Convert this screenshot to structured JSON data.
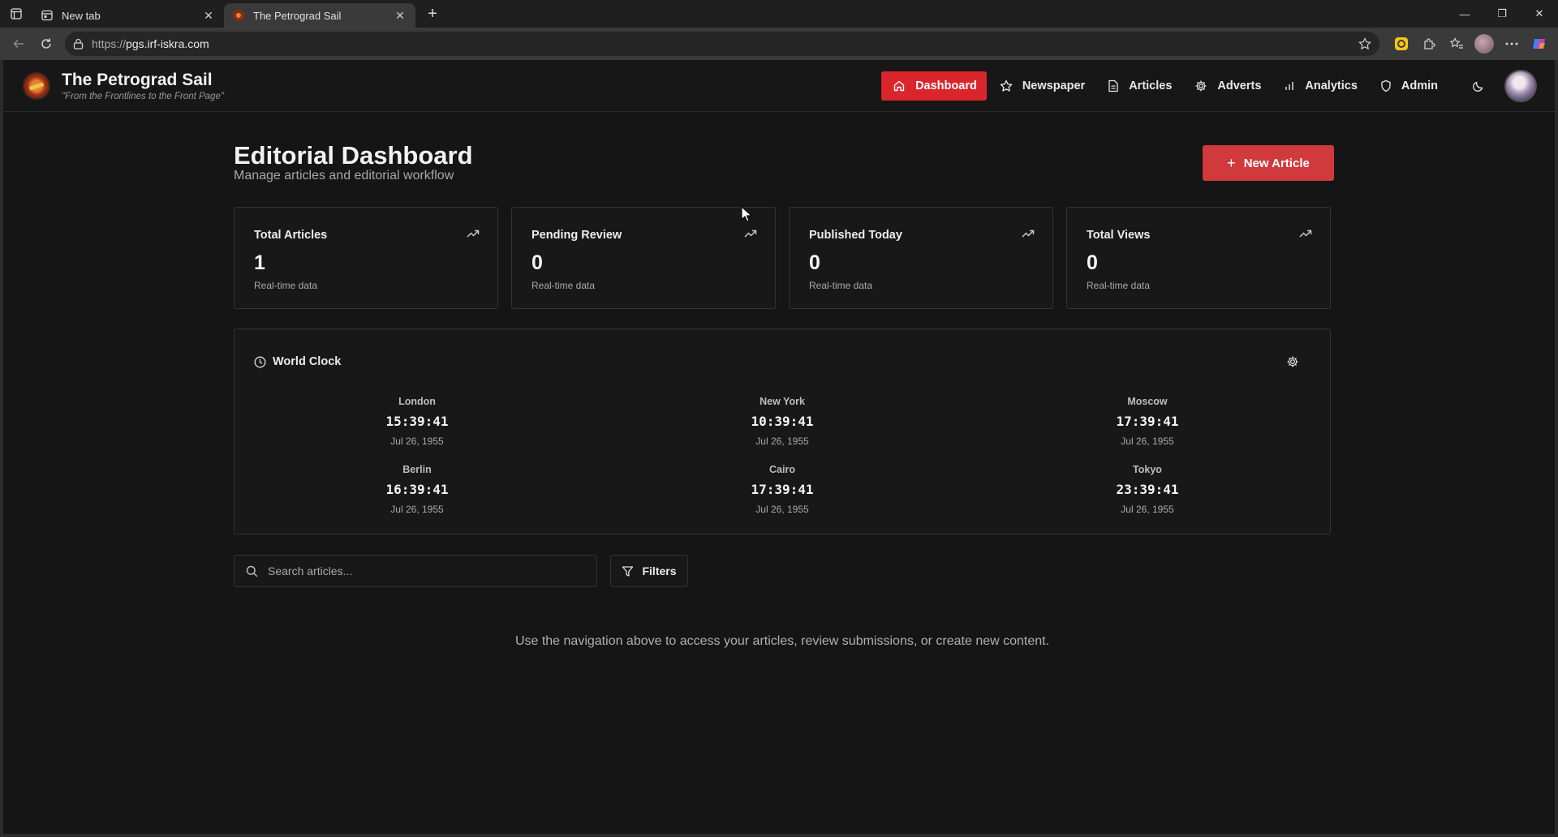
{
  "browser": {
    "tabs": [
      {
        "title": "New tab",
        "active": false
      },
      {
        "title": "The Petrograd Sail",
        "active": true
      }
    ],
    "address": {
      "protocol": "https://",
      "host": "pgs.irf-iskra.com"
    }
  },
  "site": {
    "title": "The Petrograd Sail",
    "tagline": "\"From the Frontlines to the Front Page\"",
    "nav": [
      {
        "label": "Dashboard",
        "icon": "home-icon",
        "active": true
      },
      {
        "label": "Newspaper",
        "icon": "star-icon",
        "active": false
      },
      {
        "label": "Articles",
        "icon": "document-icon",
        "active": false
      },
      {
        "label": "Adverts",
        "icon": "gear-icon",
        "active": false
      },
      {
        "label": "Analytics",
        "icon": "bar-chart-icon",
        "active": false
      },
      {
        "label": "Admin",
        "icon": "shield-icon",
        "active": false
      }
    ],
    "accent": "#d9252b"
  },
  "dashboard": {
    "title": "Editorial Dashboard",
    "subtitle": "Manage articles and editorial workflow",
    "new_article_label": "New Article",
    "stats": [
      {
        "label": "Total Articles",
        "value": "1",
        "note": "Real-time data"
      },
      {
        "label": "Pending Review",
        "value": "0",
        "note": "Real-time data"
      },
      {
        "label": "Published Today",
        "value": "0",
        "note": "Real-time data"
      },
      {
        "label": "Total Views",
        "value": "0",
        "note": "Real-time data"
      }
    ],
    "world_clock": {
      "title": "World Clock",
      "clocks": [
        {
          "city": "London",
          "time": "15:39:41",
          "date": "Jul 26, 1955"
        },
        {
          "city": "New York",
          "time": "10:39:41",
          "date": "Jul 26, 1955"
        },
        {
          "city": "Moscow",
          "time": "17:39:41",
          "date": "Jul 26, 1955"
        },
        {
          "city": "Berlin",
          "time": "16:39:41",
          "date": "Jul 26, 1955"
        },
        {
          "city": "Cairo",
          "time": "17:39:41",
          "date": "Jul 26, 1955"
        },
        {
          "city": "Tokyo",
          "time": "23:39:41",
          "date": "Jul 26, 1955"
        }
      ]
    },
    "search": {
      "placeholder": "Search articles..."
    },
    "filters_label": "Filters",
    "hint": "Use the navigation above to access your articles, review submissions, or create new content."
  }
}
